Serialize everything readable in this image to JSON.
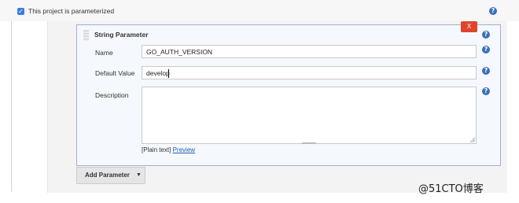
{
  "parameterized": {
    "checked": true,
    "check_glyph": "✓",
    "label": "This project is parameterized",
    "help_icon": "question-icon"
  },
  "string_parameter": {
    "title": "String Parameter",
    "delete_label": "X",
    "name_label": "Name",
    "name_value": "GO_AUTH_VERSION",
    "default_label": "Default Value",
    "default_value": "develop",
    "description_label": "Description",
    "description_value": "",
    "plain_text": "[Plain text]",
    "preview_label": "Preview"
  },
  "help_glyph": "?",
  "add_parameter": {
    "label": "Add Parameter",
    "caret": "▼"
  },
  "watermark": "@51CTO博客",
  "colors": {
    "accent": "#3a6fb9",
    "delete": "#e0452b",
    "panel_border": "#9eb3cf",
    "link": "#2060b5"
  }
}
